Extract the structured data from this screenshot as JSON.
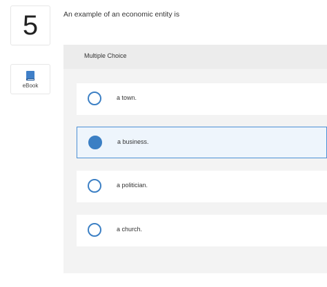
{
  "question": {
    "number": "5",
    "prompt": "An example of an economic entity is"
  },
  "ebook": {
    "label": "eBook"
  },
  "multiple_choice": {
    "header": "Multiple Choice",
    "options": [
      {
        "label": "a town.",
        "selected": false
      },
      {
        "label": "a business.",
        "selected": true
      },
      {
        "label": "a politician.",
        "selected": false
      },
      {
        "label": "a church.",
        "selected": false
      }
    ]
  },
  "colors": {
    "accent": "#3b7fc4",
    "selected_bg": "#eef5fc",
    "panel_bg": "#f3f3f3"
  }
}
